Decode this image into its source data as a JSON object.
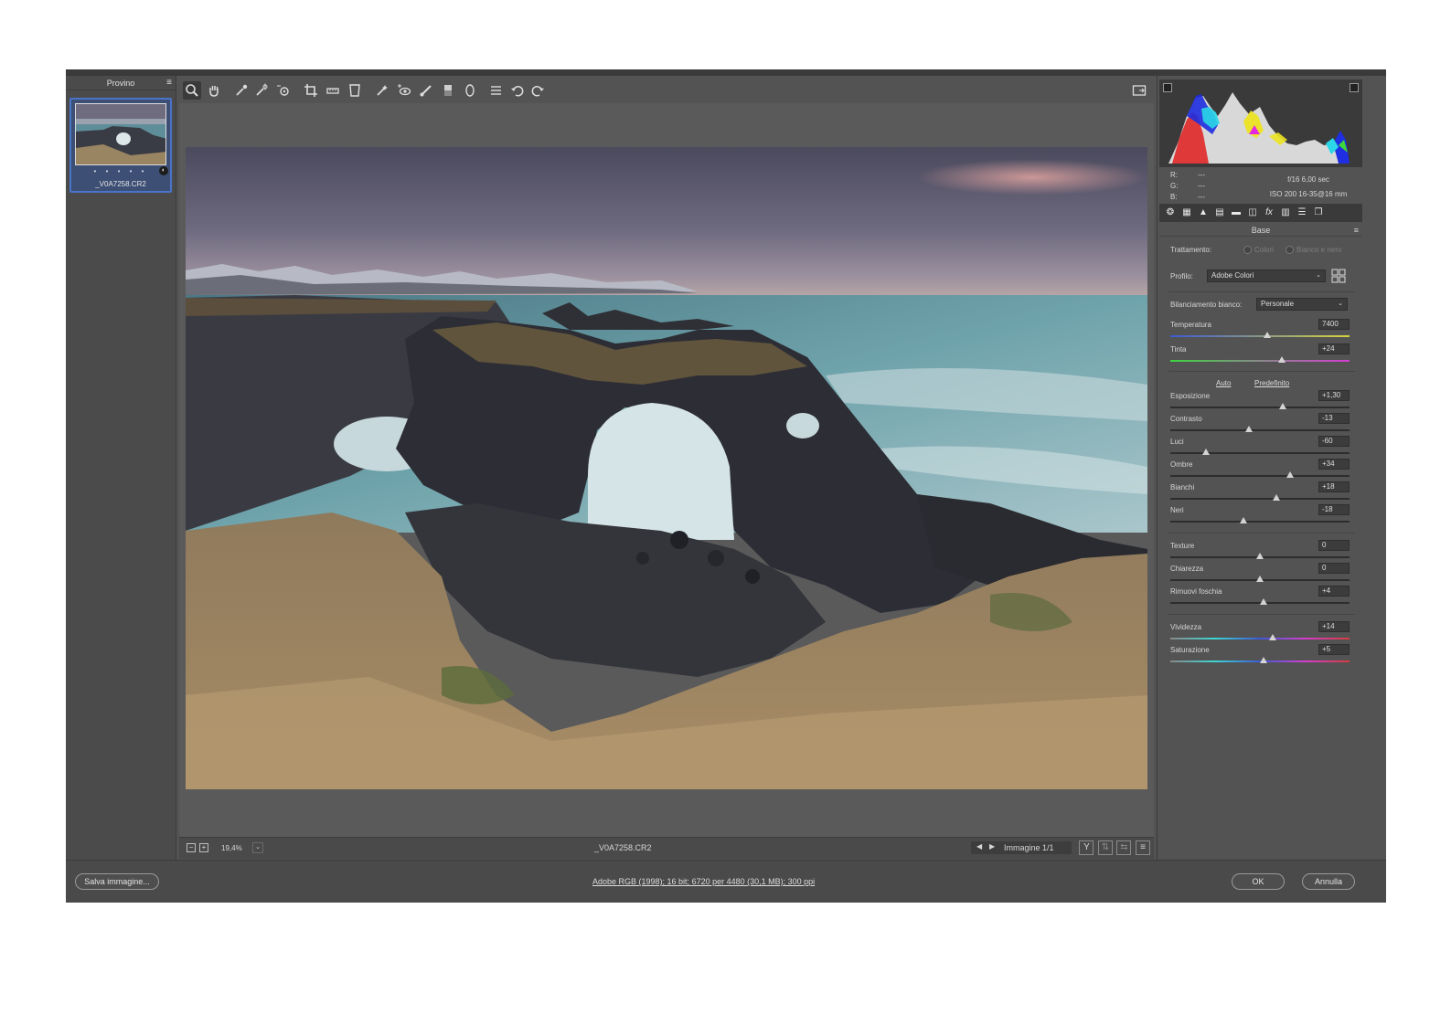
{
  "filmstrip": {
    "title": "Provino",
    "thumb_name": "_V0A7258.CR2",
    "stars": "• • • • •"
  },
  "toolbar": {
    "tools": [
      "zoom-icon",
      "hand-icon",
      "white-balance-icon",
      "color-sampler-icon",
      "targeted-adjust-icon",
      "crop-icon",
      "straighten-icon",
      "transform-icon",
      "spot-removal-icon",
      "red-eye-icon",
      "brush-icon",
      "graduated-filter-icon",
      "radial-filter-icon",
      "presets-icon",
      "rotate-left-icon",
      "rotate-right-icon"
    ]
  },
  "status": {
    "zoom": "19,4%",
    "filename": "_V0A7258.CR2",
    "image_counter": "Immagine 1/1"
  },
  "exif": {
    "r": "R:",
    "g": "G:",
    "b": "B:",
    "dash": "---",
    "aperture_shutter": "f/16   6,00 sec",
    "iso_lens": "ISO 200   16-35@16 mm"
  },
  "panel": {
    "title": "Base",
    "treatment_label": "Trattamento:",
    "treatment_color": "Colori",
    "treatment_bw": "Bianco e nero",
    "profile_label": "Profilo:",
    "profile_value": "Adobe Colori",
    "wb_label": "Bilanciamento bianco:",
    "wb_value": "Personale",
    "auto": "Auto",
    "default": "Predefinito",
    "sliders": {
      "temperatura": {
        "label": "Temperatura",
        "value": "7400",
        "pos": 0.54
      },
      "tinta": {
        "label": "Tinta",
        "value": "+24",
        "pos": 0.62
      },
      "esposizione": {
        "label": "Esposizione",
        "value": "+1,30",
        "pos": 0.63
      },
      "contrasto": {
        "label": "Contrasto",
        "value": "-13",
        "pos": 0.44
      },
      "luci": {
        "label": "Luci",
        "value": "-60",
        "pos": 0.2
      },
      "ombre": {
        "label": "Ombre",
        "value": "+34",
        "pos": 0.67
      },
      "bianchi": {
        "label": "Bianchi",
        "value": "+18",
        "pos": 0.59
      },
      "neri": {
        "label": "Neri",
        "value": "-18",
        "pos": 0.41
      },
      "texture": {
        "label": "Texture",
        "value": "0",
        "pos": 0.5
      },
      "chiarezza": {
        "label": "Chiarezza",
        "value": "0",
        "pos": 0.5
      },
      "foschia": {
        "label": "Rimuovi foschia",
        "value": "+4",
        "pos": 0.52
      },
      "vividezza": {
        "label": "Vividezza",
        "value": "+14",
        "pos": 0.57
      },
      "saturazione": {
        "label": "Saturazione",
        "value": "+5",
        "pos": 0.52
      }
    }
  },
  "footer": {
    "save": "Salva immagine...",
    "workflow": "Adobe RGB (1998); 16 bit; 6720 per 4480 (30,1 MB); 300 ppi",
    "ok": "OK",
    "cancel": "Annulla"
  }
}
